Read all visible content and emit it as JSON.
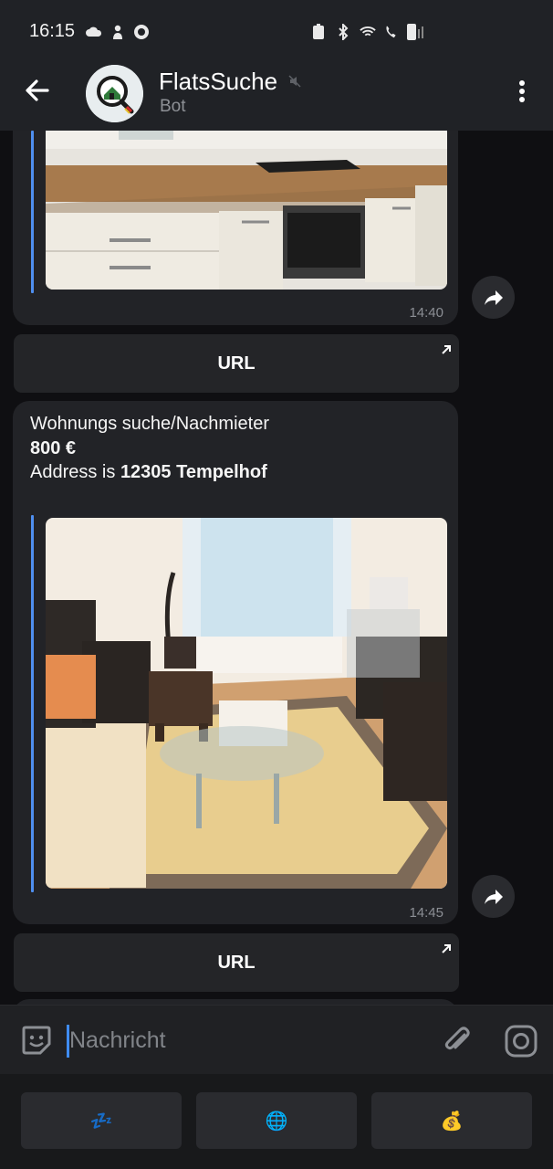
{
  "status_bar": {
    "time": "16:15"
  },
  "header": {
    "title": "FlatsSuche",
    "subtitle": "Bot"
  },
  "messages": [
    {
      "time": "14:40",
      "button_label": "URL"
    },
    {
      "line1": "Wohnungs suche/Nachmieter",
      "price": "800 €",
      "address_prefix": "Address is ",
      "address": "12305 Tempelhof",
      "time": "14:45",
      "button_label": "URL"
    }
  ],
  "input": {
    "placeholder": "Nachricht"
  },
  "keyboard": {
    "buttons": [
      {
        "label": "💤",
        "icon": "sleep-icon"
      },
      {
        "label": "🌐",
        "icon": "globe-icon"
      },
      {
        "label": "💰",
        "icon": "money-bag-icon"
      }
    ]
  },
  "colors": {
    "accent": "#4f8ff0",
    "bubble": "#222327",
    "background": "#0f0f12"
  }
}
